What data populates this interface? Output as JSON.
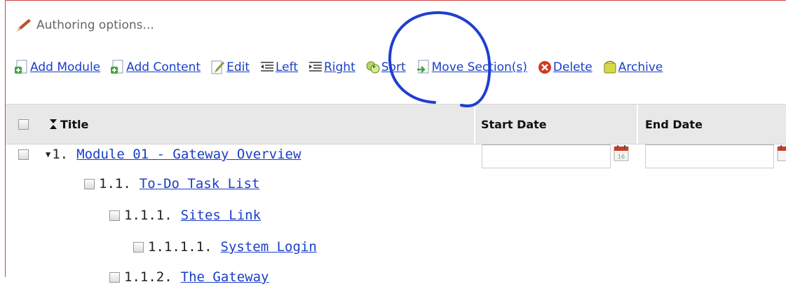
{
  "authoring": {
    "label": "Authoring options..."
  },
  "toolbar": {
    "items": [
      {
        "label": "Add Module",
        "icon": "add-module-icon"
      },
      {
        "label": "Add Content",
        "icon": "add-content-icon"
      },
      {
        "label": "Edit",
        "icon": "edit-icon"
      },
      {
        "label": "Left",
        "icon": "outdent-icon"
      },
      {
        "label": "Right",
        "icon": "indent-icon"
      },
      {
        "label": "Sort",
        "icon": "sort-icon"
      },
      {
        "label": "Move Section(s)",
        "icon": "move-icon"
      },
      {
        "label": "Delete",
        "icon": "delete-icon"
      },
      {
        "label": "Archive",
        "icon": "archive-icon"
      }
    ]
  },
  "table": {
    "headers": {
      "title": "Title",
      "start_date": "Start Date",
      "end_date": "End Date"
    },
    "rows": [
      {
        "number": "1.",
        "title": "Module 01 - Gateway Overview",
        "expanded": true
      },
      {
        "number": "1.1.",
        "title": "To-Do Task List"
      },
      {
        "number": "1.1.1.",
        "title": "Sites Link"
      },
      {
        "number": "1.1.1.1.",
        "title": "System Login"
      },
      {
        "number": "1.1.2.",
        "title": "The Gateway"
      }
    ]
  },
  "colors": {
    "link": "#1a3ec8",
    "annotation_circle": "#1f3fd0",
    "header_bg": "#e8e8e8"
  }
}
